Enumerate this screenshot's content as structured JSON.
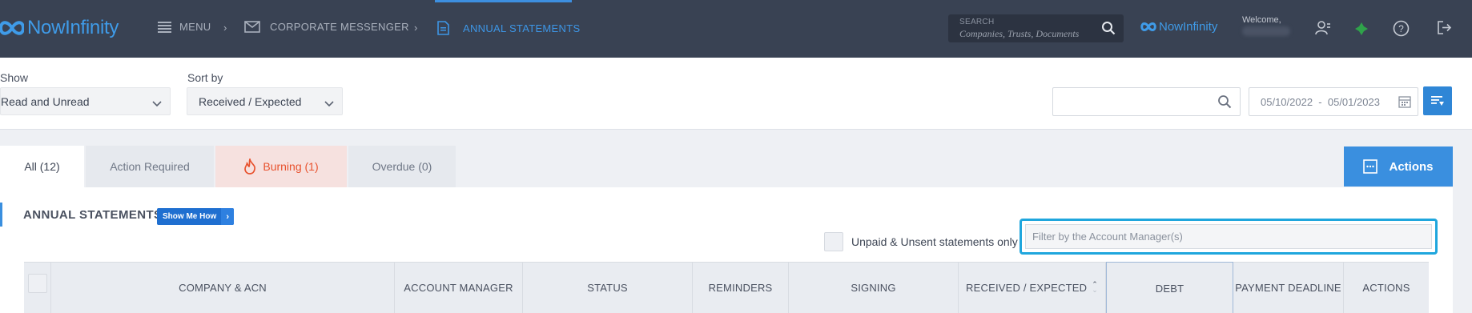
{
  "topbar": {
    "logo_text": "NowInfinity",
    "menu_label": "MENU",
    "breadcrumb_1": "CORPORATE MESSENGER",
    "breadcrumb_2": "ANNUAL STATEMENTS",
    "search_label": "SEARCH",
    "search_placeholder": "Companies,  Trusts,  Documents",
    "brand_text": "NowInfinity",
    "welcome": "Welcome,"
  },
  "toolbar": {
    "show_label": "Show",
    "show_value": "Read and Unread",
    "sort_label": "Sort by",
    "sort_value": "Received / Expected",
    "date_from": "05/10/2022",
    "date_to": "05/01/2023"
  },
  "tabs": [
    {
      "label": "All (12)",
      "active": true
    },
    {
      "label": "Action Required",
      "active": false
    },
    {
      "label": "Burning (1)",
      "active": false
    },
    {
      "label": "Overdue (0)",
      "active": false
    }
  ],
  "actions_label": "Actions",
  "panel": {
    "title": "ANNUAL STATEMENTS",
    "show_me_how": "Show Me How",
    "unpaid_label": "Unpaid & Unsent statements only",
    "manager_placeholder": "Filter by the Account Manager(s)"
  },
  "table": {
    "columns": [
      "COMPANY & ACN",
      "ACCOUNT MANAGER",
      "STATUS",
      "REMINDERS",
      "SIGNING",
      "RECEIVED / EXPECTED",
      "DEBT",
      "PAYMENT DEADLINE",
      "ACTIONS"
    ]
  },
  "colors": {
    "topbar": "#394253",
    "accent": "#3a8fdf",
    "burning": "#e8522e",
    "highlight": "#1fa6dd"
  }
}
